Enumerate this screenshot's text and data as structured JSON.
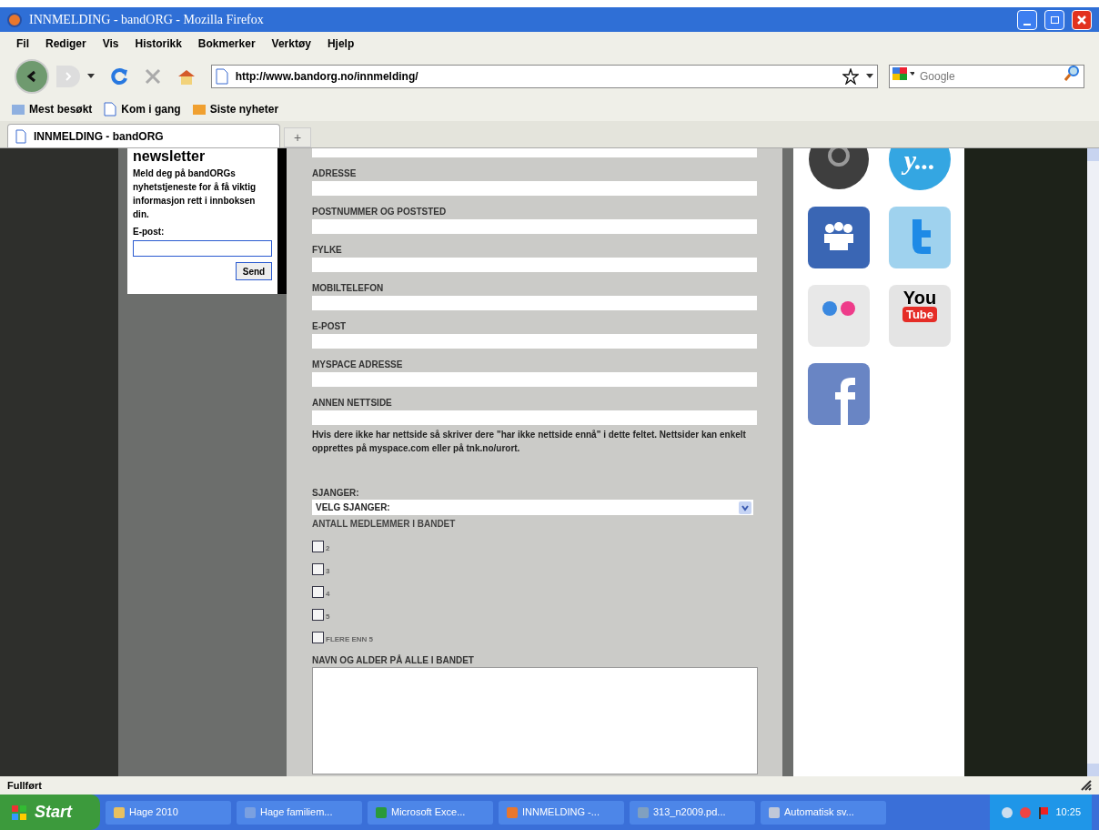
{
  "window": {
    "title": "INNMELDING - bandORG - Mozilla Firefox"
  },
  "menu": [
    "Fil",
    "Rediger",
    "Vis",
    "Historikk",
    "Bokmerker",
    "Verktøy",
    "Hjelp"
  ],
  "address_bar": {
    "value": "http://www.bandorg.no/innmelding/"
  },
  "search": {
    "placeholder": "Google"
  },
  "bookmarks": [
    "Mest besøkt",
    "Kom i gang",
    "Siste nyheter"
  ],
  "tabs": [
    {
      "label": "INNMELDING - bandORG",
      "selected": true
    }
  ],
  "new_tab": "+",
  "newsletter": {
    "heading": "newsletter",
    "text": "Meld deg på bandORGs nyhetstjeneste for å få viktig informasjon rett i innboksen din.",
    "email_label": "E-post:",
    "button": "Send"
  },
  "form": {
    "fields": [
      {
        "label": "ADRESSE"
      },
      {
        "label": "POSTNUMMER OG POSTSTED"
      },
      {
        "label": "FYLKE"
      },
      {
        "label": "MOBILTELEFON"
      },
      {
        "label": "E-POST"
      },
      {
        "label": "MYSPACE ADRESSE"
      },
      {
        "label": "ANNEN NETTSIDE"
      }
    ],
    "hint": "Hvis dere ikke har nettside så skriver dere \"har ikke nettside ennå\" i dette feltet. Nettsider kan enkelt opprettes på myspace.com eller på tnk.no/urort.",
    "genre_label": "SJANGER:",
    "genre_select": "VELG SJANGER:",
    "members_label": "ANTALL MEDLEMMER I BANDET",
    "members": [
      {
        "label": "2",
        "checked": false
      },
      {
        "label": "3",
        "checked": false
      },
      {
        "label": "4",
        "checked": false
      },
      {
        "label": "5",
        "checked": false
      },
      {
        "label": "FLERE ENN 5",
        "checked": false
      }
    ],
    "names_label": "NAVN OG ALDER PÅ ALLE I BANDET"
  },
  "social": [
    {
      "kind": "round-dark"
    },
    {
      "kind": "round-blue",
      "text": "y..."
    },
    {
      "kind": "people"
    },
    {
      "kind": "bird"
    },
    {
      "kind": "dots"
    },
    {
      "kind": "video",
      "text": "You",
      "text2": "Tube"
    },
    {
      "kind": "f"
    }
  ],
  "status_bar": "Fullført",
  "taskbar": {
    "start": "Start",
    "items": [
      "Hage 2010",
      "Hage familiem...",
      "Microsoft Exce...",
      "INNMELDING -...",
      "313_n2009.pd...",
      "Automatisk sv..."
    ],
    "clock": "10:25"
  }
}
